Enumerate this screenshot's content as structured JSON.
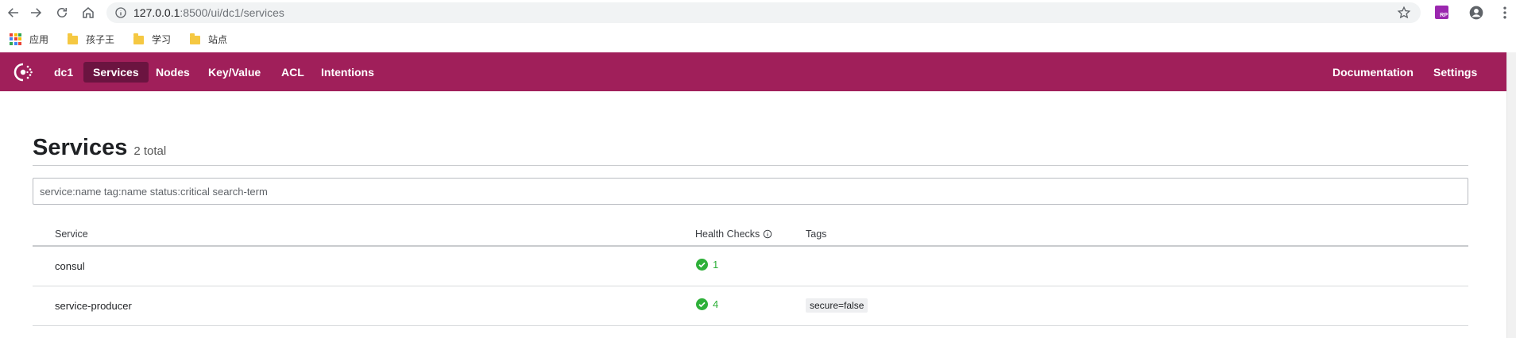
{
  "browser": {
    "url_host": "127.0.0.1",
    "url_rest": ":8500/ui/dc1/services",
    "icons": {
      "back": "back-arrow-icon",
      "forward": "forward-arrow-icon",
      "reload": "reload-icon",
      "home": "home-icon",
      "info": "info-icon",
      "star": "star-icon",
      "profile": "profile-icon",
      "menu": "more-vertical-icon"
    },
    "bookmarks": [
      {
        "label": "应用",
        "icon": "apps-grid-icon"
      },
      {
        "label": "孩子王",
        "icon": "folder-icon"
      },
      {
        "label": "学习",
        "icon": "folder-icon"
      },
      {
        "label": "站点",
        "icon": "folder-icon"
      }
    ]
  },
  "nav": {
    "datacenter": "dc1",
    "items": [
      {
        "label": "Services",
        "active": true
      },
      {
        "label": "Nodes",
        "active": false
      },
      {
        "label": "Key/Value",
        "active": false
      },
      {
        "label": "ACL",
        "active": false
      },
      {
        "label": "Intentions",
        "active": false
      }
    ],
    "right": {
      "documentation": "Documentation",
      "settings": "Settings"
    },
    "brand_color": "#a01f5a",
    "active_color": "#6b1440"
  },
  "page": {
    "title": "Services",
    "count": "2 total"
  },
  "search": {
    "placeholder": "service:name tag:name status:critical search-term",
    "value": ""
  },
  "table": {
    "headers": {
      "service": "Service",
      "health": "Health Checks",
      "tags": "Tags"
    },
    "rows": [
      {
        "name": "consul",
        "passing": "1",
        "tags": []
      },
      {
        "name": "service-producer",
        "passing": "4",
        "tags": [
          "secure=false"
        ]
      }
    ],
    "passing_color": "#2eb039"
  }
}
